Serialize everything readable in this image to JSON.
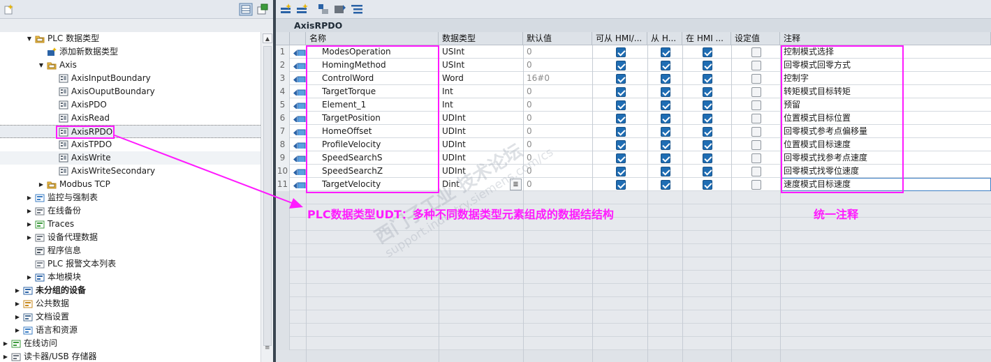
{
  "tree": {
    "items": [
      {
        "label": "PLC 数据类型",
        "indent": 2,
        "expander": "▼",
        "icon": "plc-data-types-folder-icon",
        "bold": false
      },
      {
        "label": "添加新数据类型",
        "indent": 3,
        "expander": "",
        "icon": "add-new-data-type-icon",
        "bold": false
      },
      {
        "label": "Axis",
        "indent": 3,
        "expander": "▼",
        "icon": "folder-icon",
        "bold": false
      },
      {
        "label": "AxisInputBoundary",
        "indent": 4,
        "expander": "",
        "icon": "udt-icon",
        "bold": false
      },
      {
        "label": "AxisOuputBoundary",
        "indent": 4,
        "expander": "",
        "icon": "udt-icon",
        "bold": false
      },
      {
        "label": "AxisPDO",
        "indent": 4,
        "expander": "",
        "icon": "udt-icon",
        "bold": false
      },
      {
        "label": "AxisRead",
        "indent": 4,
        "expander": "",
        "icon": "udt-icon",
        "bold": false
      },
      {
        "label": "AxisRPDO",
        "indent": 4,
        "expander": "",
        "icon": "udt-icon",
        "bold": false,
        "selected": true
      },
      {
        "label": "AxisTPDO",
        "indent": 4,
        "expander": "",
        "icon": "udt-icon",
        "bold": false
      },
      {
        "label": "AxisWrite",
        "indent": 4,
        "expander": "",
        "icon": "udt-icon",
        "bold": false,
        "hover": true
      },
      {
        "label": "AxisWriteSecondary",
        "indent": 4,
        "expander": "",
        "icon": "udt-icon",
        "bold": false
      },
      {
        "label": "Modbus TCP",
        "indent": 3,
        "expander": "▶",
        "icon": "folder-icon",
        "bold": false
      },
      {
        "label": "监控与强制表",
        "indent": 2,
        "expander": "▶",
        "icon": "watch-table-icon",
        "bold": false
      },
      {
        "label": "在线备份",
        "indent": 2,
        "expander": "▶",
        "icon": "online-backup-icon",
        "bold": false
      },
      {
        "label": "Traces",
        "indent": 2,
        "expander": "▶",
        "icon": "traces-icon",
        "bold": false
      },
      {
        "label": "设备代理数据",
        "indent": 2,
        "expander": "▶",
        "icon": "device-proxy-icon",
        "bold": false
      },
      {
        "label": "程序信息",
        "indent": 2,
        "expander": "",
        "icon": "program-info-icon",
        "bold": false
      },
      {
        "label": "PLC 报警文本列表",
        "indent": 2,
        "expander": "",
        "icon": "alarm-text-list-icon",
        "bold": false
      },
      {
        "label": "本地模块",
        "indent": 2,
        "expander": "▶",
        "icon": "local-modules-icon",
        "bold": false
      },
      {
        "label": "未分组的设备",
        "indent": 1,
        "expander": "▶",
        "icon": "ungrouped-devices-icon",
        "bold": true
      },
      {
        "label": "公共数据",
        "indent": 1,
        "expander": "▶",
        "icon": "common-data-icon",
        "bold": false
      },
      {
        "label": "文档设置",
        "indent": 1,
        "expander": "▶",
        "icon": "document-settings-icon",
        "bold": false
      },
      {
        "label": "语言和资源",
        "indent": 1,
        "expander": "▶",
        "icon": "languages-resources-icon",
        "bold": false
      },
      {
        "label": "在线访问",
        "indent": 0,
        "expander": "▶",
        "icon": "online-access-icon",
        "bold": false
      },
      {
        "label": "读卡器/USB 存储器",
        "indent": 0,
        "expander": "▶",
        "icon": "card-reader-icon",
        "bold": false
      }
    ]
  },
  "editor": {
    "title": "AxisRPDO",
    "headers": {
      "name": "名称",
      "type": "数据类型",
      "default": "默认值",
      "hmi_access": "可从 HMI/...",
      "hmi_write": "从 H...",
      "hmi_visible": "在 HMI ...",
      "setpoint": "设定值",
      "comment": "注释"
    },
    "rows": [
      {
        "no": "1",
        "name": "ModesOperation",
        "type": "USInt",
        "default": "0",
        "hmi1": true,
        "hmi2": true,
        "hmi3": true,
        "setpoint": false,
        "comment": "控制模式选择"
      },
      {
        "no": "2",
        "name": "HomingMethod",
        "type": "USInt",
        "default": "0",
        "hmi1": true,
        "hmi2": true,
        "hmi3": true,
        "setpoint": false,
        "comment": "回零模式回零方式"
      },
      {
        "no": "3",
        "name": "ControlWord",
        "type": "Word",
        "default": "16#0",
        "hmi1": true,
        "hmi2": true,
        "hmi3": true,
        "setpoint": false,
        "comment": "控制字"
      },
      {
        "no": "4",
        "name": "TargetTorque",
        "type": "Int",
        "default": "0",
        "hmi1": true,
        "hmi2": true,
        "hmi3": true,
        "setpoint": false,
        "comment": "转矩模式目标转矩"
      },
      {
        "no": "5",
        "name": "Element_1",
        "type": "Int",
        "default": "0",
        "hmi1": true,
        "hmi2": true,
        "hmi3": true,
        "setpoint": false,
        "comment": "预留"
      },
      {
        "no": "6",
        "name": "TargetPosition",
        "type": "UDInt",
        "default": "0",
        "hmi1": true,
        "hmi2": true,
        "hmi3": true,
        "setpoint": false,
        "comment": "位置模式目标位置"
      },
      {
        "no": "7",
        "name": "HomeOffset",
        "type": "UDInt",
        "default": "0",
        "hmi1": true,
        "hmi2": true,
        "hmi3": true,
        "setpoint": false,
        "comment": "回零模式参考点偏移量"
      },
      {
        "no": "8",
        "name": "ProfileVelocity",
        "type": "UDInt",
        "default": "0",
        "hmi1": true,
        "hmi2": true,
        "hmi3": true,
        "setpoint": false,
        "comment": "位置模式目标速度"
      },
      {
        "no": "9",
        "name": "SpeedSearchS",
        "type": "UDInt",
        "default": "0",
        "hmi1": true,
        "hmi2": true,
        "hmi3": true,
        "setpoint": false,
        "comment": "回零模式找参考点速度"
      },
      {
        "no": "10",
        "name": "SpeedSearchZ",
        "type": "UDInt",
        "default": "0",
        "hmi1": true,
        "hmi2": true,
        "hmi3": true,
        "setpoint": false,
        "comment": "回零模式找零位速度"
      },
      {
        "no": "11",
        "name": "TargetVelocity",
        "type": "Dint",
        "default": "0",
        "hmi1": true,
        "hmi2": true,
        "hmi3": true,
        "setpoint": false,
        "comment": "速度模式目标速度"
      }
    ]
  },
  "annotations": {
    "udt_note": "PLC数据类型UDT：多种不同数据类型元素组成的数据结结构",
    "comment_note": "统一注释",
    "color": "#ff1aff"
  },
  "watermark": {
    "line1": "西门子工业  技术论坛",
    "line2": "support.industry.siemens.com/cs"
  },
  "colors": {
    "checkbox_on": "#1f6db3",
    "annotation": "#ff1aff",
    "selection": "#e8ecf1"
  }
}
